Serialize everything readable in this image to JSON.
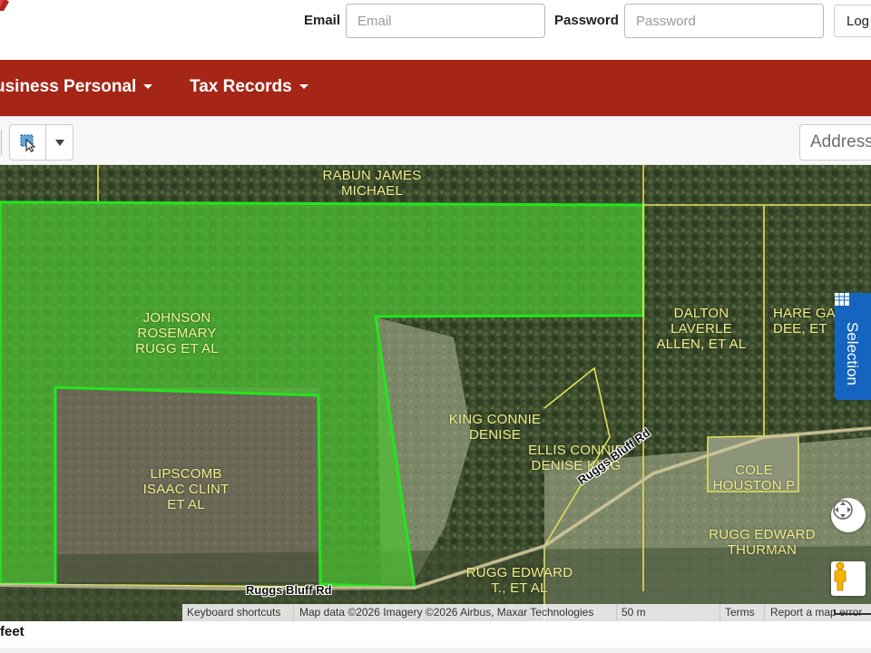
{
  "header": {
    "email_label": "Email",
    "email_placeholder": "Email",
    "password_label": "Password",
    "password_placeholder": "Password",
    "login_button": "Log"
  },
  "nav": {
    "items": [
      {
        "label": "usiness Personal"
      },
      {
        "label": "Tax Records"
      }
    ]
  },
  "toolbar": {
    "address_placeholder": "Address"
  },
  "map": {
    "parcels": [
      {
        "label": "RABUN JAMES\nMICHAEL"
      },
      {
        "label": "JOHNSON\nROSEMARY\nRUGG ET AL"
      },
      {
        "label": "LIPSCOMB\nISAAC CLINT\nET AL"
      },
      {
        "label": "KING CONNIE\nDENISE"
      },
      {
        "label": "ELLIS CONNIE\nDENISE KING"
      },
      {
        "label": "DALTON\nLAVERLE\nALLEN, ET AL"
      },
      {
        "label": "HARE GA\nDEE, ET"
      },
      {
        "label": "COLE\nHOUSTON P"
      },
      {
        "label": "RUGG EDWARD\nTHURMAN"
      },
      {
        "label": "RUGG EDWARD\nT., ET AL"
      }
    ],
    "roads": [
      {
        "label": "Ruggs Bluff Rd"
      },
      {
        "label": "Ruggs Bluff Rd"
      }
    ],
    "selection_tab": "Selection",
    "attribution": {
      "shortcuts": "Keyboard shortcuts",
      "map_data": "Map data ©2026 Imagery ©2026 Airbus, Maxar Technologies",
      "scale": "50 m",
      "terms": "Terms",
      "report": "Report a map error"
    },
    "colors": {
      "selected_fill": "#4cc232",
      "selected_outline": "#22e61c",
      "parcel_line": "#e3df5a",
      "selection_tab": "#1565c0"
    }
  },
  "footer": {
    "text": "feet"
  },
  "colors": {
    "nav_background": "#a52617"
  }
}
